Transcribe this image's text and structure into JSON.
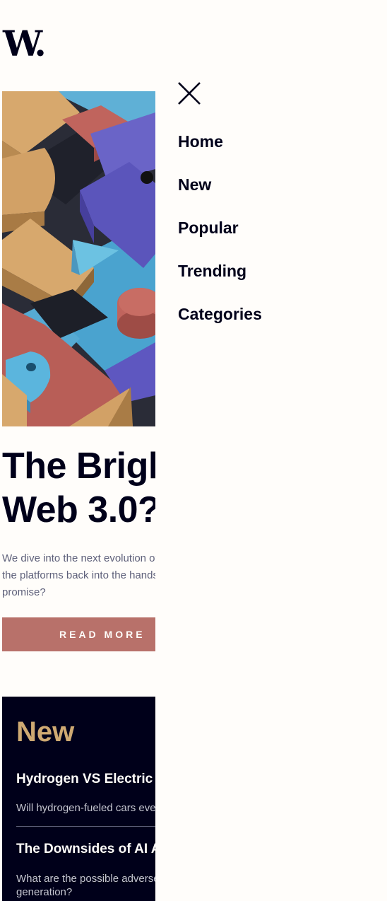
{
  "brand": {
    "logo_text": "W."
  },
  "hero": {
    "title_lines": [
      "The Bright Future of",
      "Web 3.0?"
    ],
    "description_lines": [
      "We dive into the next evolution of the web that claims to put",
      "the platforms back into the hands of the people. But is it really fulfilling its",
      "promise?"
    ],
    "cta_label": "READ MORE",
    "image_alt": "Abstract 3D colorful blocks"
  },
  "new_section": {
    "heading": "New",
    "items": [
      {
        "title": "Hydrogen VS Electric Cars",
        "description_lines": [
          "Will hydrogen-fueled cars ever catch up to EVs?"
        ]
      },
      {
        "title": "The Downsides of AI Artistry",
        "description_lines": [
          "What are the possible adverse effects of on-demand AI image",
          "generation?"
        ]
      }
    ]
  },
  "drawer": {
    "close_icon": "close-icon",
    "nav_items": [
      "Home",
      "New",
      "Popular",
      "Trending",
      "Categories"
    ]
  },
  "colors": {
    "background": "#fffdfa",
    "text_dark": "#00001a",
    "accent_red": "#b8716a",
    "accent_gold": "#cea972",
    "muted_text": "#5d5f79"
  }
}
